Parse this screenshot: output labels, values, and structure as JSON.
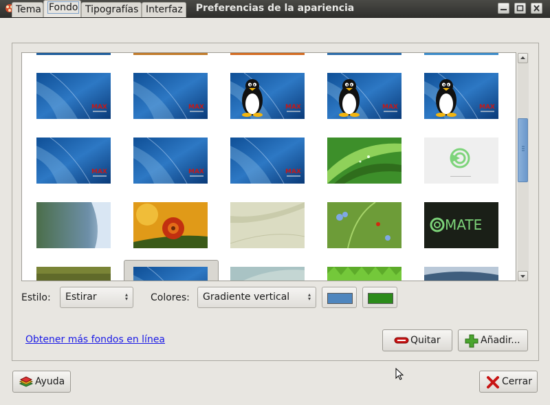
{
  "window": {
    "title": "Preferencias de la apariencia"
  },
  "tabs": [
    {
      "label": "Tema"
    },
    {
      "label": "Fondo"
    },
    {
      "label": "Tipografías"
    },
    {
      "label": "Interfaz"
    }
  ],
  "gallery": {
    "rows": [
      [
        "max-blue",
        "max-blue",
        "max-tux",
        "max-tux",
        "max-tux"
      ],
      [
        "max-blue",
        "max-blue",
        "max-blue",
        "green-leaf",
        "mate-white"
      ],
      [
        "blue-swirl",
        "red-flower",
        "beige-sand",
        "green-ladybug",
        "mate-dark"
      ],
      [
        "olive",
        "max-blue-selected",
        "teal-soft",
        "grass",
        "blue-horizon"
      ]
    ],
    "mate_logo_text": "MATE",
    "max_logo_text": "MAX"
  },
  "controls": {
    "style_label": "Estilo:",
    "style_value": "Estirar",
    "colors_label": "Colores:",
    "colors_value": "Gradiente vertical",
    "primary_color": "#4f86be",
    "secondary_color": "#2b8b1a"
  },
  "link_more": "Obtener más fondos en línea",
  "buttons": {
    "remove": "Quitar",
    "add": "Añadir...",
    "help": "Ayuda",
    "close": "Cerrar"
  }
}
